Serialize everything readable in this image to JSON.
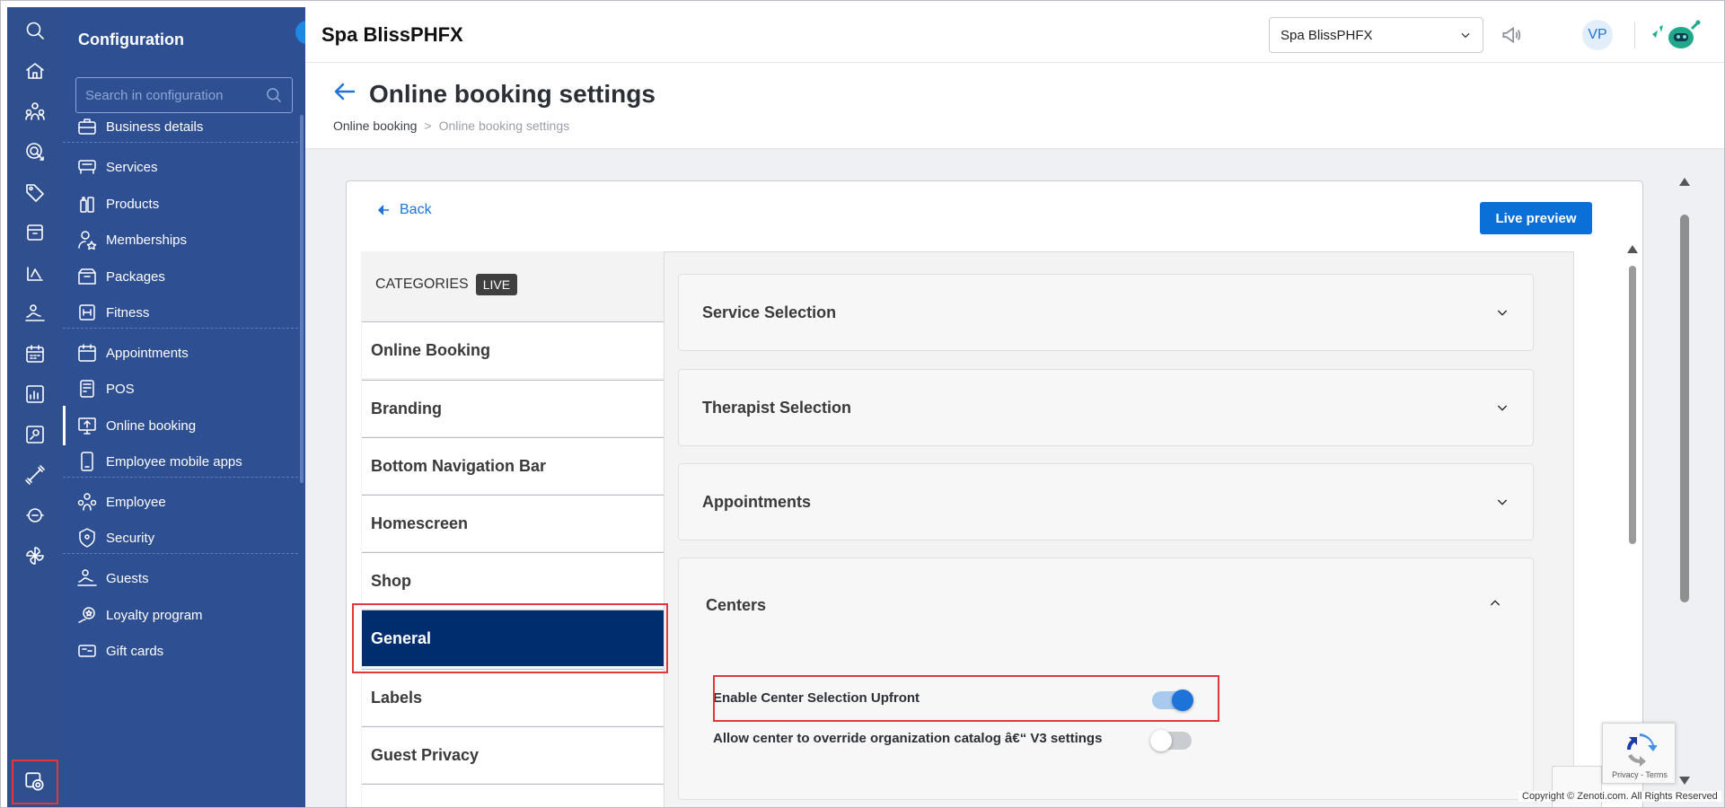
{
  "sidebar": {
    "title": "Configuration",
    "search_placeholder": "Search in configuration",
    "items": [
      {
        "label": "Business details",
        "icon": "briefcase-icon"
      },
      {
        "label": "Services",
        "icon": "spa-icon"
      },
      {
        "label": "Products",
        "icon": "bottle-icon"
      },
      {
        "label": "Memberships",
        "icon": "member-icon"
      },
      {
        "label": "Packages",
        "icon": "package-icon"
      },
      {
        "label": "Fitness",
        "icon": "fitness-icon"
      },
      {
        "label": "Appointments",
        "icon": "calendar-icon"
      },
      {
        "label": "POS",
        "icon": "pos-icon"
      },
      {
        "label": "Online booking",
        "icon": "monitor-upload-icon"
      },
      {
        "label": "Employee mobile apps",
        "icon": "mobile-app-icon"
      },
      {
        "label": "Employee",
        "icon": "people-icon"
      },
      {
        "label": "Security",
        "icon": "shield-icon"
      },
      {
        "label": "Guests",
        "icon": "guests-icon"
      },
      {
        "label": "Loyalty program",
        "icon": "loyalty-icon"
      },
      {
        "label": "Gift cards",
        "icon": "gift-card-icon"
      }
    ],
    "active": "Online booking"
  },
  "header": {
    "brand": "Spa BlissPHFX",
    "center_select": "Spa BlissPHFX",
    "avatar_initials": "VP"
  },
  "page": {
    "title": "Online booking settings",
    "breadcrumb": [
      "Online booking",
      ">",
      "Online booking settings"
    ],
    "back_label": "Back",
    "live_preview_label": "Live preview"
  },
  "categories": {
    "header": "CATEGORIES",
    "badge": "LIVE",
    "items": [
      "Online Booking",
      "Branding",
      "Bottom Navigation Bar",
      "Homescreen",
      "Shop",
      "General",
      "Labels",
      "Guest Privacy"
    ],
    "selected": "General"
  },
  "sections": [
    {
      "title": "Service Selection",
      "expanded": false
    },
    {
      "title": "Therapist Selection",
      "expanded": false
    },
    {
      "title": "Appointments",
      "expanded": false
    },
    {
      "title": "Centers",
      "expanded": true
    }
  ],
  "centers_settings": [
    {
      "label": "Enable Center Selection Upfront",
      "enabled": true
    },
    {
      "label": "Allow center to override organization catalog â€“ V3 settings",
      "enabled": false
    }
  ],
  "recaptcha_text": "Privacy - Terms",
  "footer": {
    "copyright": "Copyright © Zenoti.com. All Rights Reserved"
  },
  "colors": {
    "sidebar": "#2e4f91",
    "rail": "#2f4f8f",
    "accent": "#0a6fd6",
    "selected_category": "#002d6e",
    "highlight": "#e0383b"
  }
}
